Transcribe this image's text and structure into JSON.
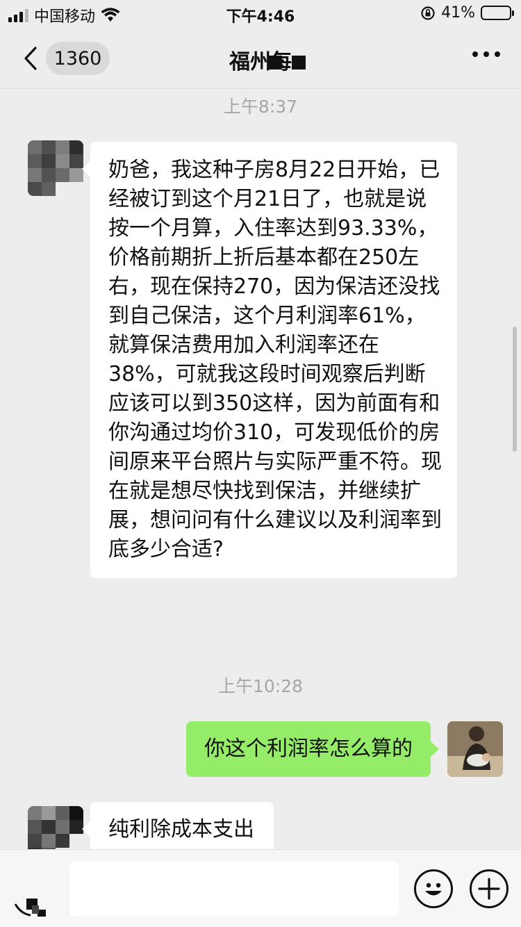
{
  "status_bar": {
    "carrier": "中国移动",
    "time": "下午4:46",
    "battery_percent": "41%",
    "battery_level": 0.41
  },
  "nav": {
    "unread_count": "1360",
    "title": "福州每"
  },
  "messages": [
    {
      "type": "time",
      "text": "上午8:37"
    },
    {
      "type": "incoming",
      "text": "奶爸，我这种子房8月22日开始，已经被订到这个月21日了，也就是说按一个月算，入住率达到93.33%，价格前期折上折后基本都在250左右，现在保持270，因为保洁还没找到自己保洁，这个月利润率61%，就算保洁费用加入利润率还在38%，可就我这段时间观察后判断应该可以到350这样，因为前面有和你沟通过均价310，可发现低价的房间原来平台照片与实际严重不符。现在就是想尽快找到保洁，并继续扩展，想问问有什么建议以及利润率到底多少合适?"
    },
    {
      "type": "time",
      "text": "上午10:28"
    },
    {
      "type": "outgoing",
      "text": "你这个利润率怎么算的"
    },
    {
      "type": "incoming",
      "text": "纯利除成本支出"
    }
  ],
  "icons": {
    "back": "chevron-left-icon",
    "more": "more-dots-icon",
    "voice": "voice-icon",
    "emoji": "emoji-icon",
    "plus": "plus-icon",
    "wifi": "wifi-icon",
    "signal": "signal-icon",
    "lock": "orientation-lock-icon",
    "battery": "battery-icon"
  },
  "colors": {
    "background": "#ededed",
    "outgoing_bubble": "#95ec69",
    "incoming_bubble": "#ffffff",
    "time_label": "#a6a6a6"
  }
}
